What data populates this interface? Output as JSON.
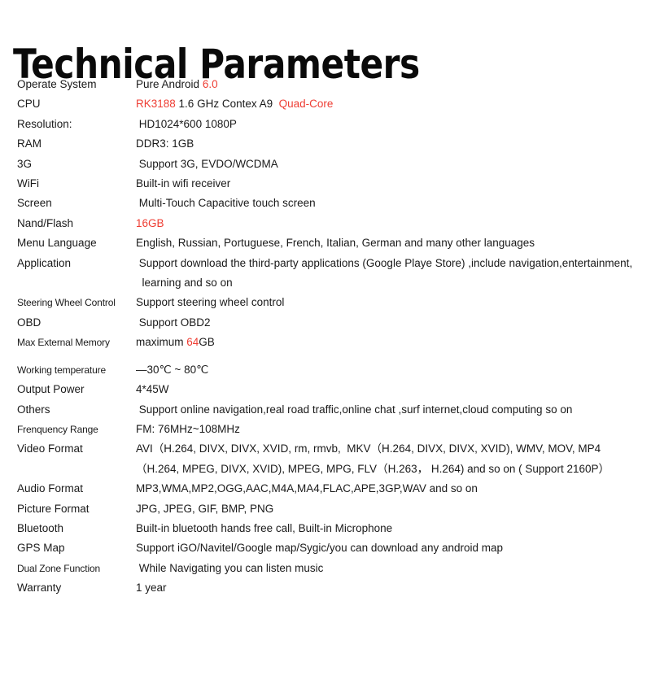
{
  "page": {
    "title": "Technical Parameters",
    "accent_red": "#ee3d33",
    "text_color": "#1a1a1a",
    "background": "#ffffff"
  },
  "specs": [
    {
      "label": "Operate System",
      "segments": [
        {
          "text": "Pure Android ",
          "color": "black"
        },
        {
          "text": "6.0",
          "color": "red"
        }
      ]
    },
    {
      "label": "CPU",
      "segments": [
        {
          "text": "RK3188",
          "color": "red"
        },
        {
          "text": " 1.6 GHz Contex A9  ",
          "color": "black"
        },
        {
          "text": "Quad-Core",
          "color": "red"
        }
      ]
    },
    {
      "label": "Resolution:",
      "segments": [
        {
          "text": " HD1024*600 1080P",
          "color": "black"
        }
      ]
    },
    {
      "label": "RAM",
      "segments": [
        {
          "text": "DDR3: 1GB",
          "color": "black"
        }
      ]
    },
    {
      "label": "3G",
      "segments": [
        {
          "text": " Support 3G, EVDO/WCDMA",
          "color": "black"
        }
      ]
    },
    {
      "label": "WiFi",
      "segments": [
        {
          "text": "Built-in wifi receiver",
          "color": "black"
        }
      ]
    },
    {
      "label": "Screen",
      "segments": [
        {
          "text": " Multi-Touch Capacitive touch screen",
          "color": "black"
        }
      ]
    },
    {
      "label": "Nand/Flash",
      "segments": [
        {
          "text": "16GB",
          "color": "red"
        }
      ]
    },
    {
      "label": "Menu Language",
      "segments": [
        {
          "text": "English, Russian, Portuguese, French, Italian, German and many other languages",
          "color": "black"
        }
      ]
    },
    {
      "label": "Application",
      "lines": [
        " Support download the third-party applications (Google Playe Store) ,include navigation,entertainment,",
        "  learning and so on"
      ]
    },
    {
      "label": "Steering Wheel Control",
      "label_style": "narrow",
      "segments": [
        {
          "text": "Support steering wheel control",
          "color": "black"
        }
      ]
    },
    {
      "label": "OBD",
      "segments": [
        {
          "text": " Support OBD2",
          "color": "black"
        }
      ]
    },
    {
      "label": "Max External Memory",
      "label_style": "narrow",
      "segments": [
        {
          "text": "maximum ",
          "color": "black"
        },
        {
          "text": "64",
          "color": "red"
        },
        {
          "text": "GB",
          "color": "black"
        }
      ]
    },
    {
      "label": "Working temperature",
      "label_style": "narrow",
      "spacing": "gap-md",
      "segments": [
        {
          "text": "—30℃ ~ 80℃",
          "color": "black"
        }
      ]
    },
    {
      "label": "Output Power",
      "segments": [
        {
          "text": "4*45W",
          "color": "black"
        }
      ]
    },
    {
      "label": "Others",
      "segments": [
        {
          "text": " Support online navigation,real road traffic,online chat ,surf internet,cloud computing so on",
          "color": "black"
        }
      ]
    },
    {
      "label": "Frenquency Range",
      "label_style": "narrow",
      "segments": [
        {
          "text": "FM: 76MHz~108MHz",
          "color": "black"
        }
      ]
    },
    {
      "label": "Video  Format",
      "lines": [
        "AVI（H.264, DIVX, DIVX, XVID, rm, rmvb,  MKV（H.264, DIVX, DIVX, XVID), WMV, MOV, MP4",
        "（H.264, MPEG, DIVX, XVID), MPEG, MPG, FLV（H.263， H.264) and so on ( Support 2160P）"
      ]
    },
    {
      "label": "Audio Format",
      "segments": [
        {
          "text": "MP3,WMA,MP2,OGG,AAC,M4A,MA4,FLAC,APE,3GP,WAV and so on",
          "color": "black"
        }
      ]
    },
    {
      "label": "Picture Format",
      "segments": [
        {
          "text": "JPG, JPEG, GIF, BMP, PNG",
          "color": "black"
        }
      ]
    },
    {
      "label": "Bluetooth",
      "segments": [
        {
          "text": "Built-in bluetooth hands free call, Built-in Microphone",
          "color": "black"
        }
      ]
    },
    {
      "label": "GPS Map",
      "segments": [
        {
          "text": "Support iGO/Navitel/Google map/Sygic/you can download any android map",
          "color": "black"
        }
      ]
    },
    {
      "label": "Dual Zone Function",
      "label_style": "narrow",
      "segments": [
        {
          "text": " While Navigating you can listen music",
          "color": "black"
        }
      ]
    },
    {
      "label": "Warranty",
      "segments": [
        {
          "text": "1 year",
          "color": "black"
        }
      ]
    }
  ]
}
